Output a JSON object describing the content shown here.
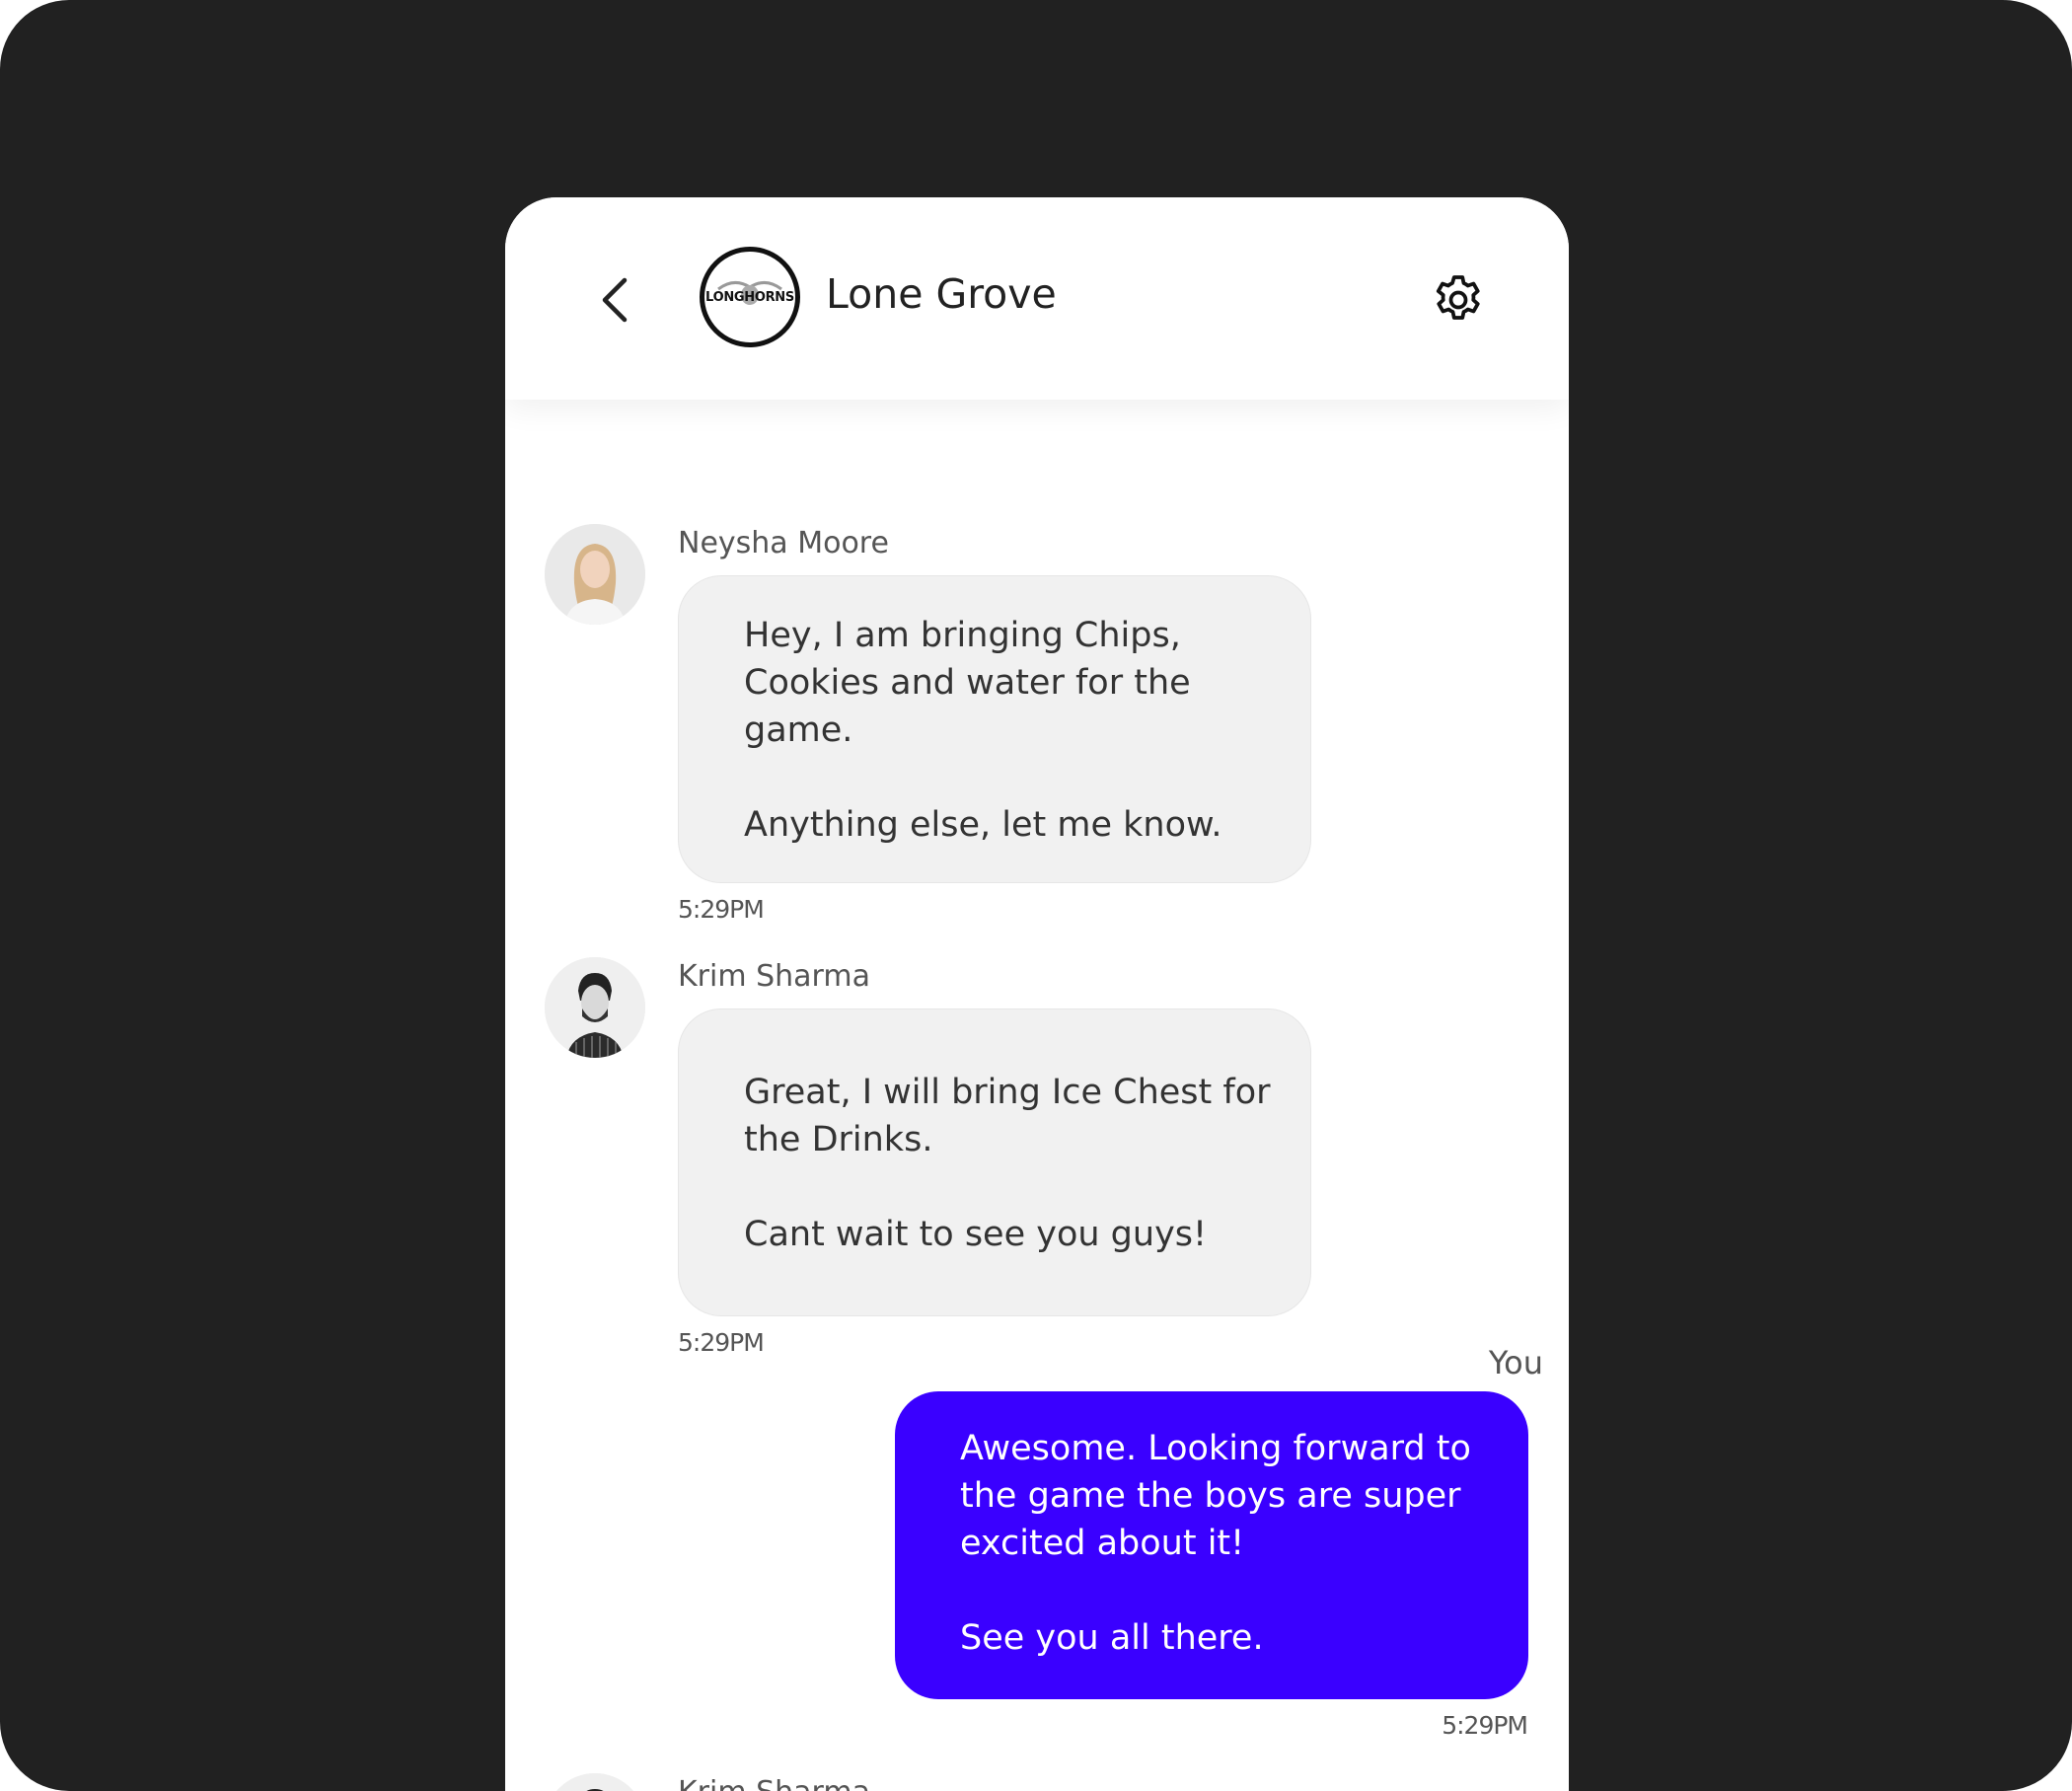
{
  "header": {
    "title": "Lone Grove",
    "logo_text": "LONGHORNS",
    "back_icon": "chevron-left-icon",
    "settings_icon": "gear-icon"
  },
  "messages": [
    {
      "sender": "Neysha Moore",
      "lines": [
        "Hey, I am bringing Chips, Cookies and water for the game.",
        "Anything else, let me know."
      ],
      "time": "5:29PM",
      "direction": "incoming"
    },
    {
      "sender": "Krim Sharma",
      "lines": [
        "Great, I will bring Ice Chest for the Drinks.",
        "Cant wait to see you guys!"
      ],
      "time": "5:29PM",
      "direction": "incoming"
    },
    {
      "sender": "You",
      "lines": [
        "Awesome. Looking forward to the game the boys are super excited about it!",
        "See you all there."
      ],
      "time": "5:29PM",
      "direction": "outgoing"
    },
    {
      "sender": "Krim Sharma",
      "direction": "incoming"
    }
  ],
  "colors": {
    "outgoing_bubble": "#3a00ff",
    "incoming_bubble": "#f1f1f1",
    "frame": "#212121"
  }
}
